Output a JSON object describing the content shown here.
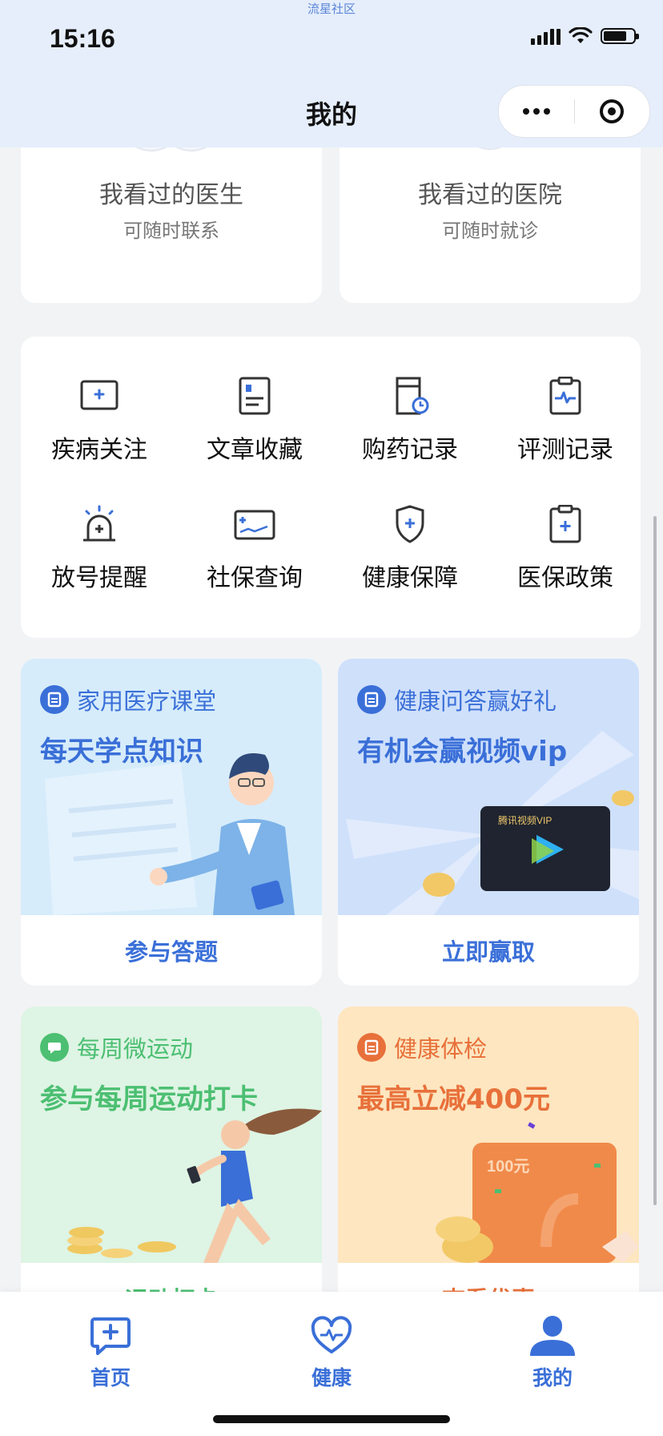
{
  "app": {
    "mini_label": "流星社区",
    "title": "我的"
  },
  "status_bar": {
    "time": "15:16"
  },
  "history": [
    {
      "title": "我看过的医生",
      "subtitle": "可随时联系"
    },
    {
      "title": "我看过的医院",
      "subtitle": "可随时就诊"
    }
  ],
  "services": [
    {
      "label": "疾病关注",
      "icon": "disease-follow-icon"
    },
    {
      "label": "文章收藏",
      "icon": "article-icon"
    },
    {
      "label": "购药记录",
      "icon": "purchase-record-icon"
    },
    {
      "label": "评测记录",
      "icon": "clipboard-pulse-icon"
    },
    {
      "label": "放号提醒",
      "icon": "alarm-light-icon"
    },
    {
      "label": "社保查询",
      "icon": "social-security-icon"
    },
    {
      "label": "健康保障",
      "icon": "shield-plus-icon"
    },
    {
      "label": "医保政策",
      "icon": "clipboard-plus-icon"
    }
  ],
  "promos": [
    {
      "tag": "家用医疗课堂",
      "slogan": "每天学点知识",
      "action": "参与答题"
    },
    {
      "tag": "健康问答赢好礼",
      "slogan": "有机会赢视频vip",
      "action": "立即赢取",
      "card_text": "腾讯视频VIP"
    },
    {
      "tag": "每周微运动",
      "slogan": "参与每周运动打卡",
      "action": "运动打卡"
    },
    {
      "tag": "健康体检",
      "slogan": "最高立减400元",
      "action": "查看优惠",
      "coupon_text": "100元"
    }
  ],
  "tabbar": [
    {
      "label": "首页",
      "icon": "chat-plus-icon"
    },
    {
      "label": "健康",
      "icon": "heart-pulse-icon"
    },
    {
      "label": "我的",
      "icon": "user-icon"
    }
  ],
  "colors": {
    "accent": "#3a6fd8",
    "green": "#4cbf72",
    "orange": "#e8703a"
  }
}
